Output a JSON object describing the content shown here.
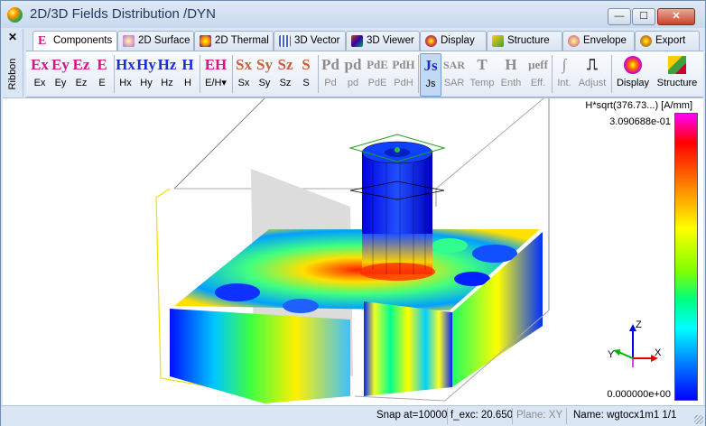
{
  "window": {
    "title": "2D/3D Fields Distribution /DYN",
    "minimize": "—",
    "maximize": "☐",
    "close": "✕"
  },
  "ribbon": {
    "close": "✕",
    "label": "Ribbon"
  },
  "tabs": [
    {
      "label": "Components",
      "icon": "E-letter-icon",
      "color": "#d4148a",
      "active": true
    },
    {
      "label": "2D Surface",
      "icon": "surface-icon",
      "color": "#c060f0"
    },
    {
      "label": "2D Thermal",
      "icon": "thermal-icon",
      "color": "#3070d0"
    },
    {
      "label": "3D Vector",
      "icon": "vector-icon",
      "color": "#4060e0"
    },
    {
      "label": "3D Viewer",
      "icon": "viewer-icon",
      "color": "#d04010"
    },
    {
      "label": "Display",
      "icon": "display-icon",
      "color": "#e05030"
    },
    {
      "label": "Structure",
      "icon": "structure-icon",
      "color": "#40a040"
    },
    {
      "label": "Envelope",
      "icon": "envelope-icon",
      "color": "#d04080"
    },
    {
      "label": "Export",
      "icon": "export-icon",
      "color": "#e08020"
    }
  ],
  "toolbar": {
    "e": [
      {
        "big": "Ex",
        "label": "Ex"
      },
      {
        "big": "Ey",
        "label": "Ey"
      },
      {
        "big": "Ez",
        "label": "Ez"
      },
      {
        "big": "E",
        "label": "E"
      }
    ],
    "h": [
      {
        "big": "Hx",
        "label": "Hx"
      },
      {
        "big": "Hy",
        "label": "Hy"
      },
      {
        "big": "Hz",
        "label": "Hz"
      },
      {
        "big": "H",
        "label": "H"
      }
    ],
    "eh": {
      "big": "EH",
      "label": "E/H▾"
    },
    "s": [
      {
        "big": "Sx",
        "label": "Sx"
      },
      {
        "big": "Sy",
        "label": "Sy"
      },
      {
        "big": "Sz",
        "label": "Sz"
      },
      {
        "big": "S",
        "label": "S"
      }
    ],
    "p": [
      {
        "big": "Pd",
        "label": "Pd"
      },
      {
        "big": "pd",
        "label": "pd"
      },
      {
        "big": "PdE",
        "label": "PdE"
      },
      {
        "big": "PdH",
        "label": "PdH"
      }
    ],
    "js": {
      "big": "Js",
      "label": "Js"
    },
    "misc": [
      {
        "big": "SAR",
        "label": "SAR"
      },
      {
        "big": "T",
        "label": "Temp"
      },
      {
        "big": "H",
        "label": "Enth"
      },
      {
        "big": "μeff",
        "label": "Eff."
      }
    ],
    "int": {
      "big": "∫",
      "label": "Int."
    },
    "adjust": {
      "big": "⎍",
      "label": "Adjust"
    },
    "display": {
      "label": "Display"
    },
    "structure": {
      "label": "Structure"
    },
    "colors": {
      "e": "#d4148a",
      "h": "#1a2fd0",
      "s": "#c8603c",
      "disabled": "#9a9a9a"
    }
  },
  "legend": {
    "title": "H*sqrt(376.73...) [A/mm]",
    "max": "3.090688e-01",
    "min": "0.000000e+00"
  },
  "axes": {
    "z": "Z",
    "x": "X",
    "y": "Y"
  },
  "status": {
    "snap": "Snap at=10000",
    "fexc": "f_exc: 20.650",
    "plane": "Plane: XY",
    "name": "Name: wgtocx1m1 1/1"
  }
}
